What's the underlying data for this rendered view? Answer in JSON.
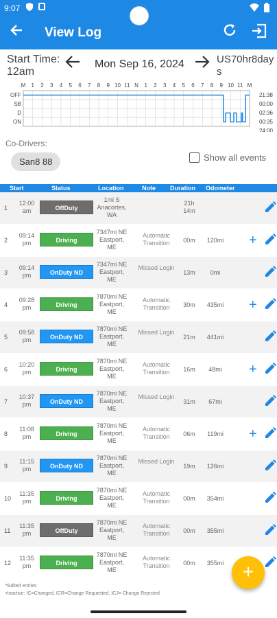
{
  "status_bar": {
    "time": "9:07"
  },
  "app_bar": {
    "title": "View Log"
  },
  "date_row": {
    "start_label": "Start Time:",
    "start_value": "12am",
    "date": "Mon Sep 16, 2024",
    "rule": "US70hr8days"
  },
  "graph": {
    "hour_labels": [
      "M",
      "1",
      "2",
      "3",
      "4",
      "5",
      "6",
      "7",
      "8",
      "9",
      "10",
      "11",
      "N",
      "1",
      "2",
      "3",
      "4",
      "5",
      "6",
      "7",
      "8",
      "9",
      "10",
      "11",
      "M"
    ],
    "status_labels": [
      "OFF",
      "SB",
      "D",
      "ON"
    ],
    "totals": [
      "21:38",
      "00:00",
      "02:36",
      "00:35",
      "24:00"
    ]
  },
  "co_drivers": {
    "label": "Co-Drivers:",
    "chip": "San8 88"
  },
  "show_all": {
    "label": "Show all events",
    "checked": false
  },
  "table": {
    "headers": {
      "start": "Start",
      "status": "Status",
      "location": "Location",
      "note": "Note",
      "duration": "Duration",
      "odometer": "Odometer"
    },
    "rows": [
      {
        "idx": "1",
        "start": "12:00 am",
        "status": "OffDuty",
        "status_color": "#6d6d6d",
        "location": "1mi S Anacortes, WA",
        "note": "",
        "duration": "21h 14m",
        "odometer": "",
        "plus": false
      },
      {
        "idx": "2",
        "start": "09:14 pm",
        "status": "Driving",
        "status_color": "#4caf50",
        "location": "7347mi NE Eastport, ME",
        "note": "Automatic Transition",
        "duration": "00m",
        "odometer": "120mi",
        "plus": true
      },
      {
        "idx": "3",
        "start": "09:14 pm",
        "status": "OnDuty ND",
        "status_color": "#2196f3",
        "location": "7347mi NE Eastport, ME",
        "note": "Missed Login",
        "duration": "13m",
        "odometer": "0mi",
        "plus": false
      },
      {
        "idx": "4",
        "start": "09:28 pm",
        "status": "Driving",
        "status_color": "#4caf50",
        "location": "7870mi NE Eastport, ME",
        "note": "Automatic Transition",
        "duration": "30m",
        "odometer": "435mi",
        "plus": true
      },
      {
        "idx": "5",
        "start": "09:58 pm",
        "status": "OnDuty ND",
        "status_color": "#2196f3",
        "location": "7870mi NE Eastport, ME",
        "note": "Missed Login",
        "duration": "21m",
        "odometer": "441mi",
        "plus": false
      },
      {
        "idx": "6",
        "start": "10:20 pm",
        "status": "Driving",
        "status_color": "#4caf50",
        "location": "7870mi NE Eastport, ME",
        "note": "Automatic Transition",
        "duration": "16m",
        "odometer": "48mi",
        "plus": true
      },
      {
        "idx": "7",
        "start": "10:37 pm",
        "status": "OnDuty ND",
        "status_color": "#2196f3",
        "location": "7870mi NE Eastport, ME",
        "note": "Missed Login",
        "duration": "31m",
        "odometer": "67mi",
        "plus": false
      },
      {
        "idx": "8",
        "start": "11:08 pm",
        "status": "Driving",
        "status_color": "#4caf50",
        "location": "7870mi NE Eastport, ME",
        "note": "Automatic Transition",
        "duration": "06m",
        "odometer": "119mi",
        "plus": true
      },
      {
        "idx": "9",
        "start": "11:15 pm",
        "status": "OnDuty ND",
        "status_color": "#2196f3",
        "location": "7870mi NE Eastport, ME",
        "note": "Missed Login",
        "duration": "19m",
        "odometer": "126mi",
        "plus": false
      },
      {
        "idx": "10",
        "start": "11:35 pm",
        "status": "Driving",
        "status_color": "#4caf50",
        "location": "7870mi NE Eastport, ME",
        "note": "Automatic Transition",
        "duration": "00m",
        "odometer": "354mi",
        "plus": false
      },
      {
        "idx": "11",
        "start": "11:35 pm",
        "status": "OffDuty",
        "status_color": "#6d6d6d",
        "location": "7870mi NE Eastport, ME",
        "note": "Automatic Transition",
        "duration": "00m",
        "odometer": "355mi",
        "plus": false
      },
      {
        "idx": "12",
        "start": "11:35 pm",
        "status": "Driving",
        "status_color": "#4caf50",
        "location": "7870mi NE Eastport, ME",
        "note": "Automatic Transition",
        "duration": "00m",
        "odometer": "355mi",
        "plus": false
      }
    ]
  },
  "footnote": {
    "line1": "*Edited entries",
    "line2": "•Inactive: IC=Changed, ICR=Change Requested, ICJ= Change Rejected"
  },
  "colors": {
    "accent": "#1e88e5",
    "fab": "#ffc107",
    "driving": "#4caf50",
    "onduty": "#2196f3",
    "offduty": "#6d6d6d"
  }
}
